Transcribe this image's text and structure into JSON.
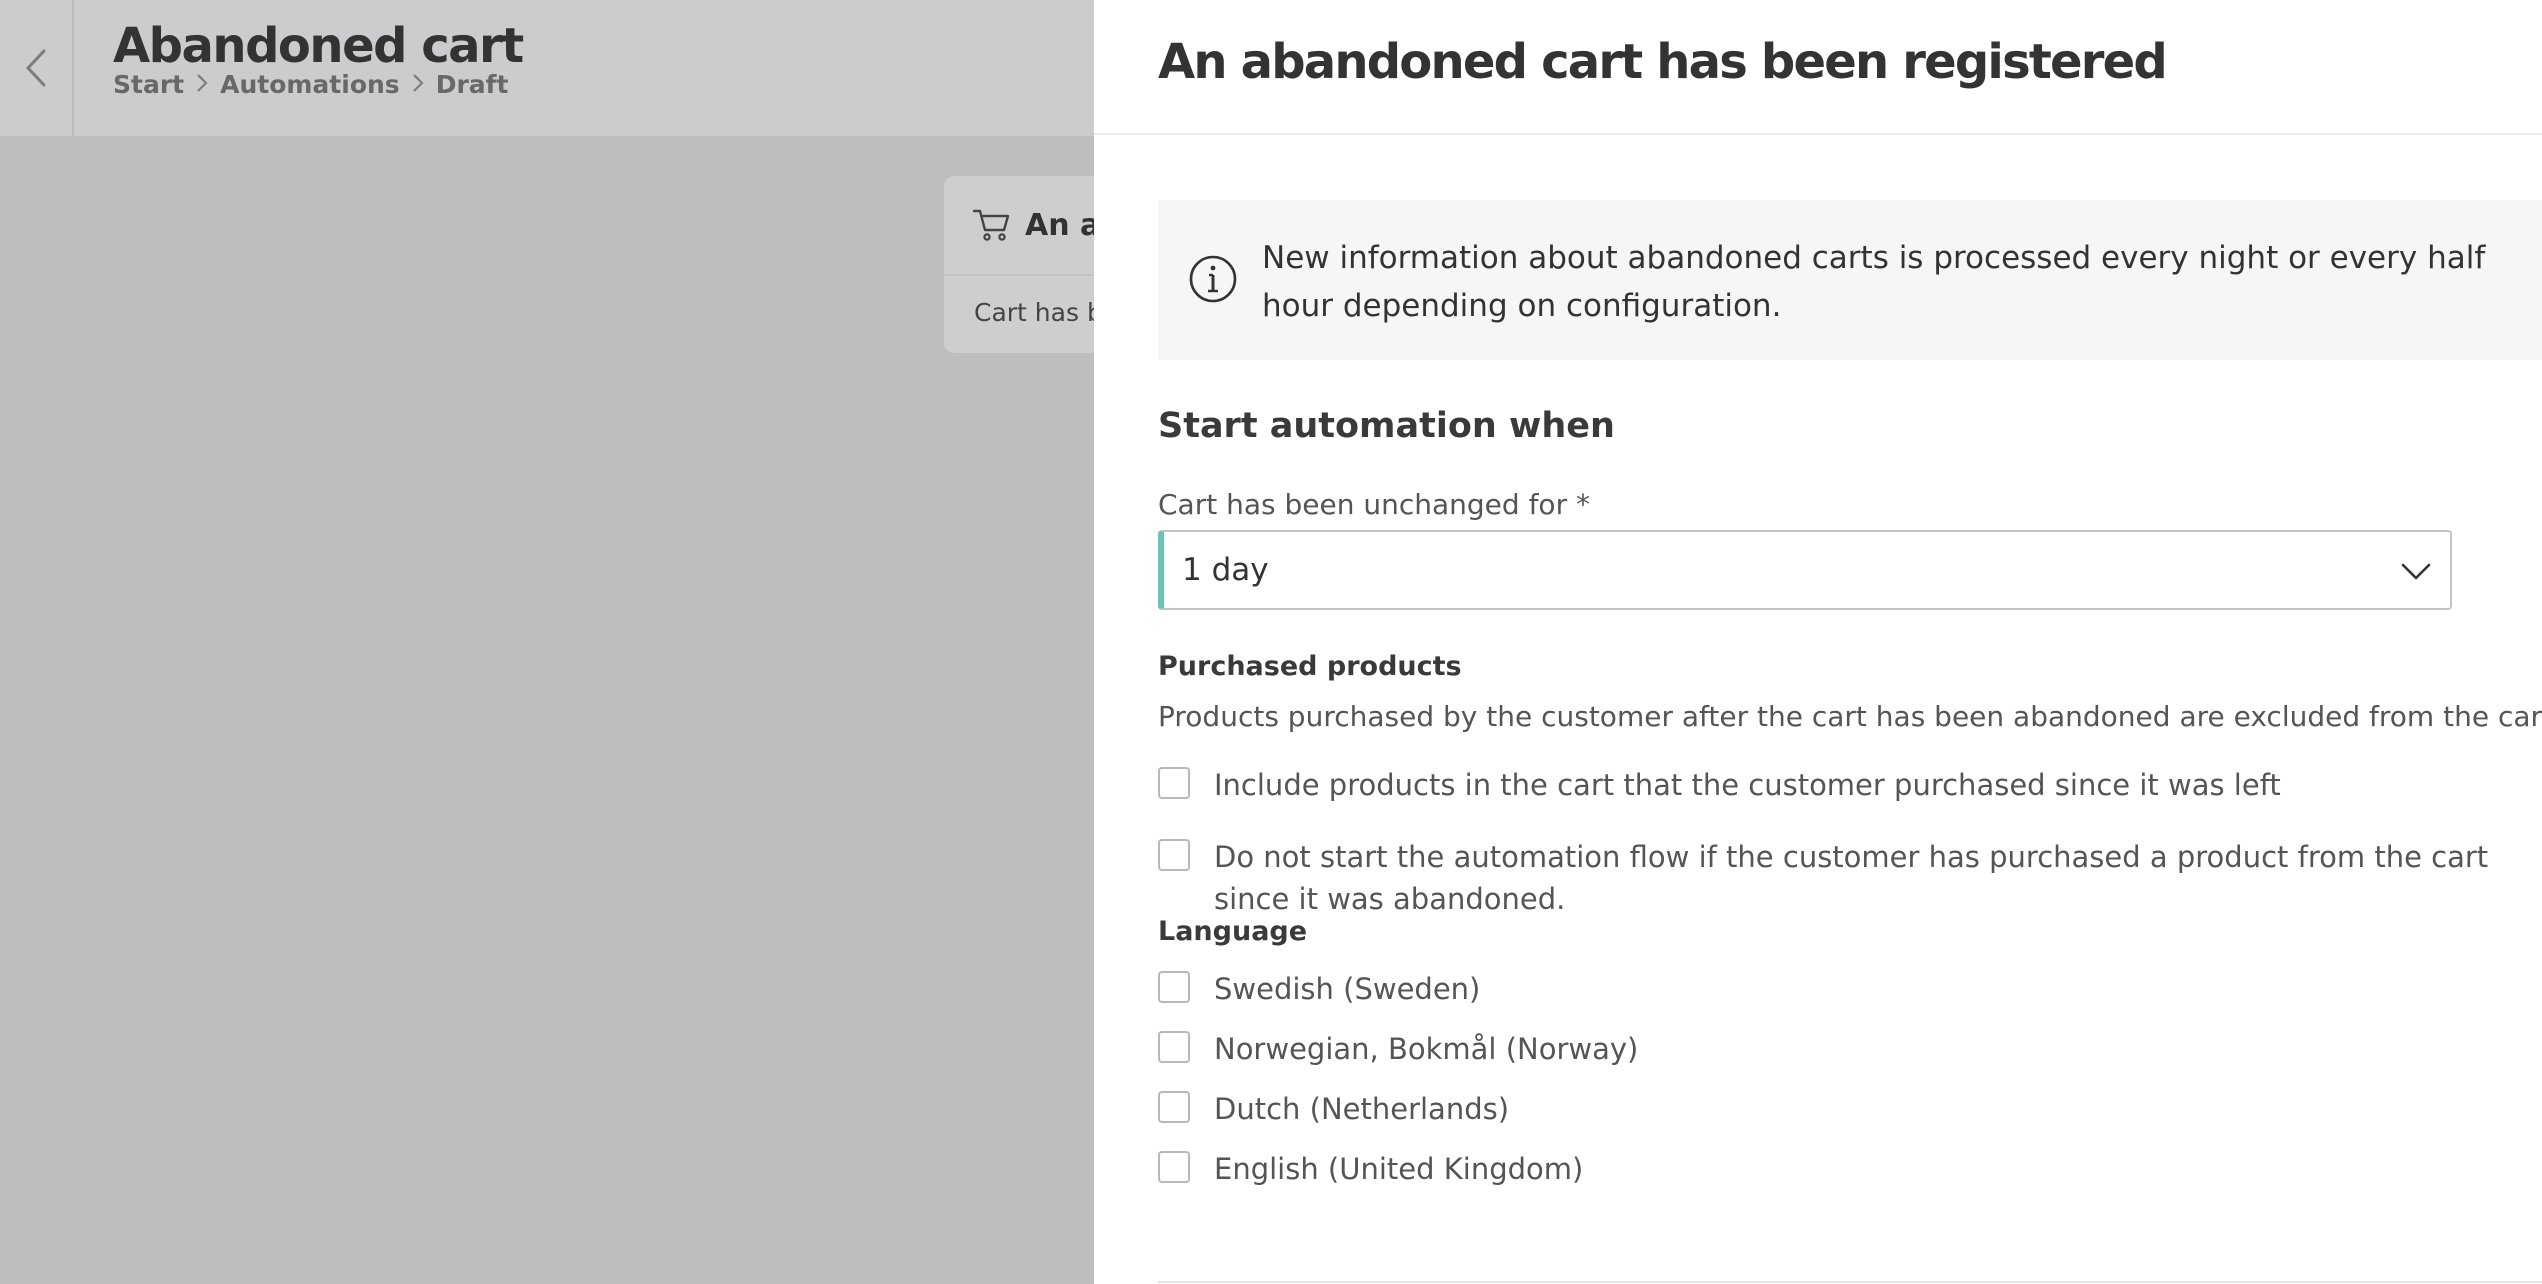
{
  "background": {
    "page_title": "Abandoned cart",
    "breadcrumb": [
      {
        "label": "Start"
      },
      {
        "label": "Automations"
      },
      {
        "label": "Draft"
      }
    ],
    "card": {
      "icon": "cart-icon",
      "title": "An ab",
      "body": "Cart has b"
    }
  },
  "drawer": {
    "title": "An abandoned cart has been registered",
    "info": {
      "icon": "info-icon",
      "text": "New information about abandoned carts is processed every night or every half hour depending on configuration."
    },
    "section_title": "Start automation when",
    "unchanged_field": {
      "label": "Cart has been unchanged for *",
      "value": "1 day"
    },
    "purchased_products": {
      "label": "Purchased products",
      "help": "Products purchased by the customer after the cart has been abandoned are excluded from the cart.",
      "options": [
        {
          "label": "Include products in the cart that the customer purchased since it was left",
          "checked": false
        },
        {
          "label": "Do not start the automation flow if the customer has purchased a product from the cart since it was abandoned.",
          "checked": false
        }
      ]
    },
    "language": {
      "label": "Language",
      "options": [
        {
          "label": "Swedish (Sweden)",
          "checked": false
        },
        {
          "label": "Norwegian, Bokmål (Norway)",
          "checked": false
        },
        {
          "label": "Dutch (Netherlands)",
          "checked": false
        },
        {
          "label": "English (United Kingdom)",
          "checked": false
        }
      ]
    }
  },
  "colors": {
    "accent": "#69c3b7",
    "overlay": "#bcbdbf",
    "info_bg": "#f6f6f4"
  }
}
